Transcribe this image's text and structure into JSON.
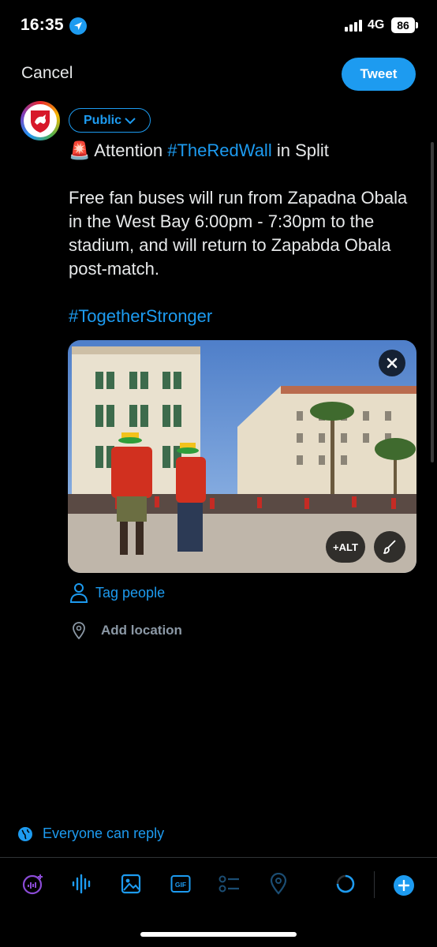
{
  "status_bar": {
    "time": "16:35",
    "network": "4G",
    "battery": "86"
  },
  "nav": {
    "cancel_label": "Cancel",
    "tweet_label": "Tweet"
  },
  "compose": {
    "audience_label": "Public",
    "line1_prefix": "🚨 Attention ",
    "line1_hashtag": "#TheRedWall",
    "line1_suffix": " in Split",
    "body": "Free fan buses will run from Zapadna Obala in the West Bay 6:00pm - 7:30pm to the stadium, and will return to Zapabda Obala post-match.",
    "hashtag2": "#TogetherStronger"
  },
  "media": {
    "alt_label": "+ALT"
  },
  "actions": {
    "tag_people": "Tag people",
    "add_location": "Add location"
  },
  "reply": {
    "label": "Everyone can reply"
  },
  "toolbar": {
    "items": [
      "spaces-icon",
      "audio-icon",
      "image-icon",
      "gif-icon",
      "poll-icon",
      "location-icon",
      "progress-icon",
      "add-icon"
    ],
    "gif_label": "GIF"
  },
  "colors": {
    "accent": "#1d9bf0",
    "background": "#000000",
    "text": "#e7e9ea",
    "muted": "#8b98a5"
  }
}
